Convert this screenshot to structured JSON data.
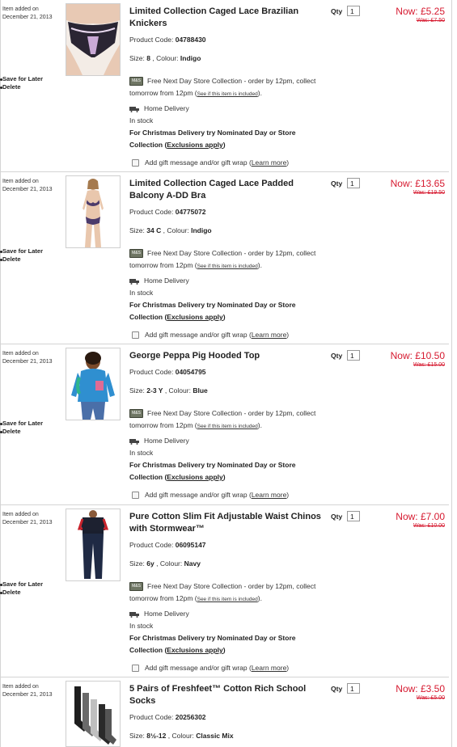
{
  "labels": {
    "item_added": "Item added on",
    "save_for_later": "Save for Later",
    "delete": "Delete",
    "product_code": "Product Code:",
    "size": "Size:",
    "colour": "Colour:",
    "qty": "Qty",
    "store_collection_a": "Free Next Day Store Collection - order by 12pm, collect",
    "store_collection_b": "tomorrow from 12pm (",
    "see_if_included": "See if this item is included",
    "home_delivery": "Home Delivery",
    "in_stock": "In stock",
    "christmas_a": "For Christmas Delivery try Nominated Day or Store",
    "christmas_b": "Collection (",
    "exclusions": "Exclusions apply",
    "gift_msg": "Add gift message and/or gift wrap (",
    "learn_more": "Learn more",
    "ms_badge": "M&S"
  },
  "items": [
    {
      "date": "December 21, 2013",
      "title": "Limited Collection Caged Lace Brazilian Knickers",
      "code": "04788430",
      "size": "8",
      "colour": "Indigo",
      "qty": "1",
      "now": "Now: £5.25",
      "was": "Was: £7.50",
      "image": "knickers-image"
    },
    {
      "date": "December 21, 2013",
      "title": "Limited Collection Caged Lace Padded Balcony A-DD Bra",
      "code": "04775072",
      "size": "34 C",
      "colour": "Indigo",
      "qty": "1",
      "now": "Now: £13.65",
      "was": "Was: £19.50",
      "image": "bra-image"
    },
    {
      "date": "December 21, 2013",
      "title": "George Peppa Pig Hooded Top",
      "code": "04054795",
      "size": "2-3 Y",
      "colour": "Blue",
      "qty": "1",
      "now": "Now: £10.50",
      "was": "Was: £15.00",
      "image": "hoodie-image"
    },
    {
      "date": "December 21, 2013",
      "title": "Pure Cotton Slim Fit Adjustable Waist Chinos with Stormwear™",
      "code": "06095147",
      "size": "6y",
      "colour": "Navy",
      "qty": "1",
      "now": "Now: £7.00",
      "was": "Was: £10.00",
      "image": "chinos-image"
    },
    {
      "date": "December 21, 2013",
      "title": "5 Pairs of Freshfeet™ Cotton Rich School Socks",
      "code": "20256302",
      "size": "8½-12",
      "colour": "Classic Mix",
      "qty": "1",
      "now": "Now: £3.50",
      "was": "Was: £5.00",
      "image": "socks-image"
    }
  ]
}
